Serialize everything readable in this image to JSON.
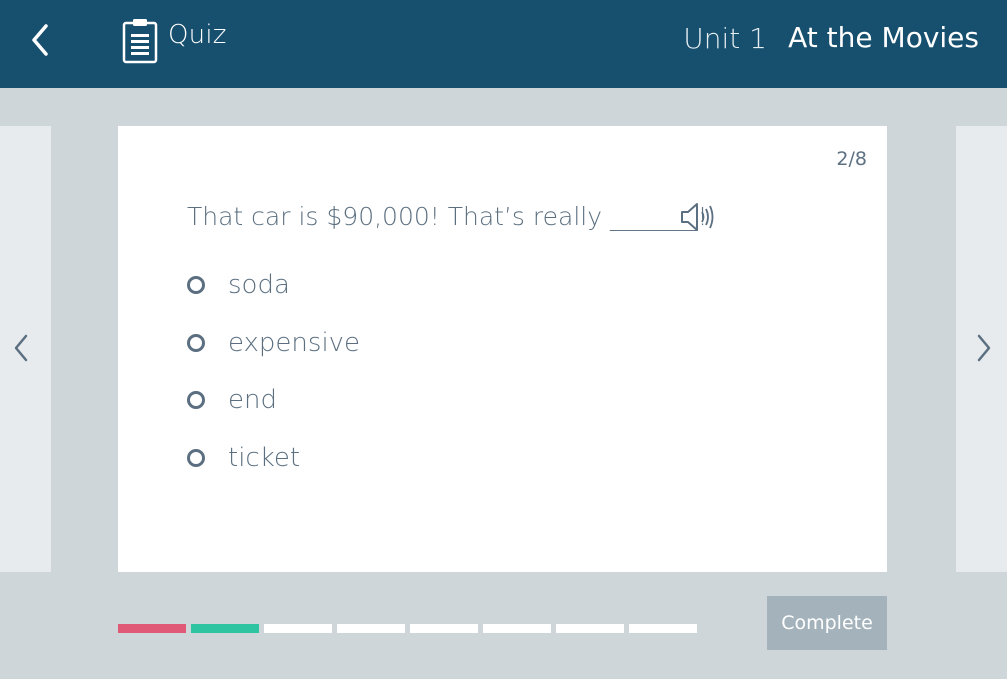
{
  "header": {
    "section_label": "Quiz",
    "unit_label": "Unit 1",
    "unit_title": "At the Movies",
    "background": "#174f6e"
  },
  "icons": {
    "back": "chevron-left-icon",
    "quiz": "clipboard-icon",
    "audio": "speaker-icon",
    "prev": "chevron-left-icon",
    "next": "chevron-right-icon"
  },
  "question": {
    "counter": "2/8",
    "text": "That car is $90,000! That’s really _______!",
    "options": [
      {
        "label": "soda",
        "selected": false
      },
      {
        "label": "expensive",
        "selected": false
      },
      {
        "label": "end",
        "selected": false
      },
      {
        "label": "ticket",
        "selected": false
      }
    ]
  },
  "progress": {
    "total": 8,
    "current": 2,
    "segments": [
      "incorrect",
      "correct",
      "pending",
      "pending",
      "pending",
      "pending",
      "pending",
      "pending"
    ],
    "colors": {
      "incorrect": "#e05a78",
      "correct": "#2ec3a1",
      "pending": "#ffffff"
    }
  },
  "actions": {
    "complete_label": "Complete"
  }
}
